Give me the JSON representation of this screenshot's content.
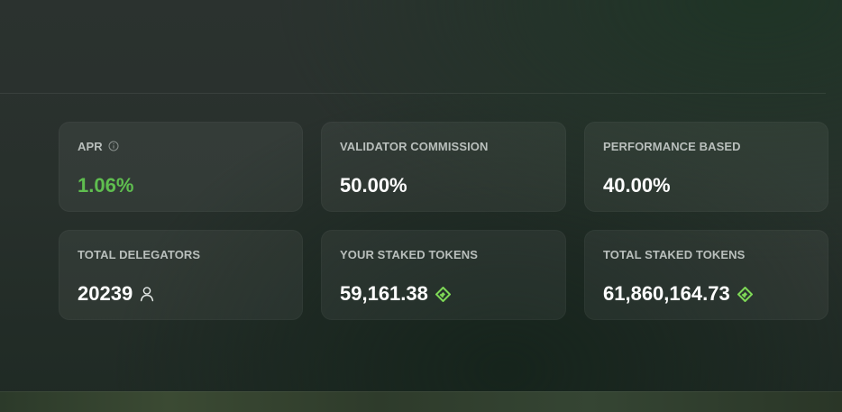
{
  "stats": [
    {
      "label": "APR",
      "value": "1.06%",
      "icon": "info-icon"
    },
    {
      "label": "VALIDATOR COMMISSION",
      "value": "50.00%"
    },
    {
      "label": "PERFORMANCE BASED",
      "value": "40.00%"
    },
    {
      "label": "TOTAL DELEGATORS",
      "value": "20239",
      "icon": "user-icon"
    },
    {
      "label": "YOUR STAKED TOKENS",
      "value": "59,161.38",
      "icon": "token-icon"
    },
    {
      "label": "TOTAL STAKED TOKENS",
      "value": "61,860,164.73",
      "icon": "token-icon"
    }
  ],
  "colors": {
    "accent_green": "#5fbe4f",
    "token_green": "#7ed957"
  }
}
